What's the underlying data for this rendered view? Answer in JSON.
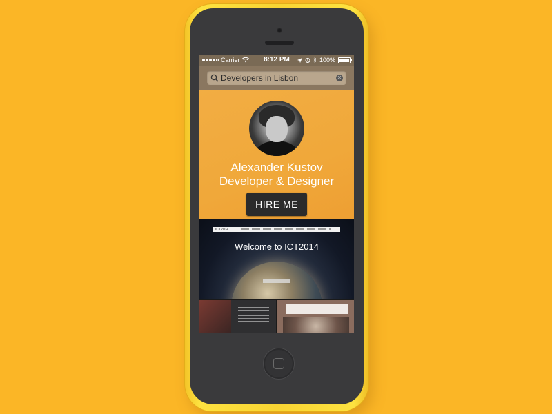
{
  "status_bar": {
    "carrier": "Carrier",
    "time": "8:12 PM",
    "battery": "100%"
  },
  "search": {
    "query": "Developers in Lisbon"
  },
  "profile": {
    "name": "Alexander Kustov",
    "role": "Developer & Designer",
    "cta_label": "HIRE ME"
  },
  "portfolio": {
    "featured_title": "Welcome to ICT2014",
    "featured_logo": "ICT2014"
  },
  "colors": {
    "background": "#fbb626",
    "hero": "#f0a93b",
    "button": "#2b2b2b"
  }
}
